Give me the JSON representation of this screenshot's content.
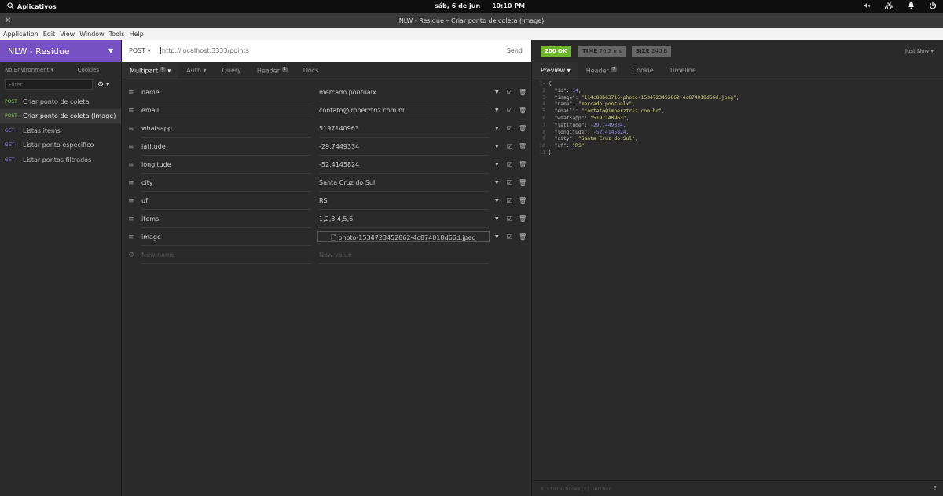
{
  "system": {
    "apps_label": "Aplicativos",
    "date": "sáb, 6 de jun",
    "time": "10:10 PM",
    "icons": [
      "speaker-muted-icon",
      "network-icon",
      "bell-icon",
      "power-icon"
    ]
  },
  "window": {
    "title": "NLW - Residue – Criar ponto de coleta (Image)"
  },
  "menu": [
    "Application",
    "Edit",
    "View",
    "Window",
    "Tools",
    "Help"
  ],
  "sidebar": {
    "workspace": "NLW - Residue",
    "environment": "No Environment",
    "cookies": "Cookies",
    "filter_placeholder": "Filter",
    "requests": [
      {
        "method": "POST",
        "name": "Criar ponto de coleta"
      },
      {
        "method": "POST",
        "name": "Criar ponto de coleta (Image)"
      },
      {
        "method": "GET",
        "name": "Listas items"
      },
      {
        "method": "GET",
        "name": "Listar ponto especifico"
      },
      {
        "method": "GET",
        "name": "Listar pontos filtrados"
      }
    ]
  },
  "request": {
    "method": "POST",
    "url": "http://localhost:3333/points",
    "send_label": "Send",
    "tabs": [
      {
        "label": "Multipart",
        "badge": "9"
      },
      {
        "label": "Auth"
      },
      {
        "label": "Query"
      },
      {
        "label": "Header",
        "badge": "1"
      },
      {
        "label": "Docs"
      }
    ],
    "params": [
      {
        "name": "name",
        "value": "mercado pontualx"
      },
      {
        "name": "email",
        "value": "contato@imperztriz.com.br"
      },
      {
        "name": "whatsapp",
        "value": "5197140963"
      },
      {
        "name": "latitude",
        "value": "-29.7449334"
      },
      {
        "name": "longitude",
        "value": "-52.4145824"
      },
      {
        "name": "city",
        "value": "Santa Cruz do Sul"
      },
      {
        "name": "uf",
        "value": "RS"
      },
      {
        "name": "items",
        "value": "1,2,3,4,5,6"
      },
      {
        "name": "image",
        "value": "photo-1534723452862-4c874018d66d.jpeg",
        "is_file": true
      }
    ],
    "new_name_placeholder": "New name",
    "new_value_placeholder": "New value"
  },
  "response": {
    "status": "200 OK",
    "time_label": "TIME",
    "time_value": "76.2 ms",
    "size_label": "SIZE",
    "size_value": "240 B",
    "when": "Just Now",
    "tabs": [
      {
        "label": "Preview"
      },
      {
        "label": "Header",
        "badge": "7"
      },
      {
        "label": "Cookie"
      },
      {
        "label": "Timeline"
      }
    ],
    "json_lines": [
      "{",
      "  \"id\": 14,",
      "  \"image\": \"114c88b63716-photo-1534723452862-4c874018d66d.jpeg\",",
      "  \"name\": \"mercado pontualx\",",
      "  \"email\": \"contato@imperztriz.com.br\",",
      "  \"whatsapp\": \"5197140963\",",
      "  \"latitude\": -29.7449334,",
      "  \"longitude\": -52.4145824,",
      "  \"city\": \"Santa Cruz do Sul\",",
      "  \"uf\": \"RS\"",
      "}"
    ],
    "filter_placeholder": "$.store.books[*].author",
    "help": "?"
  }
}
